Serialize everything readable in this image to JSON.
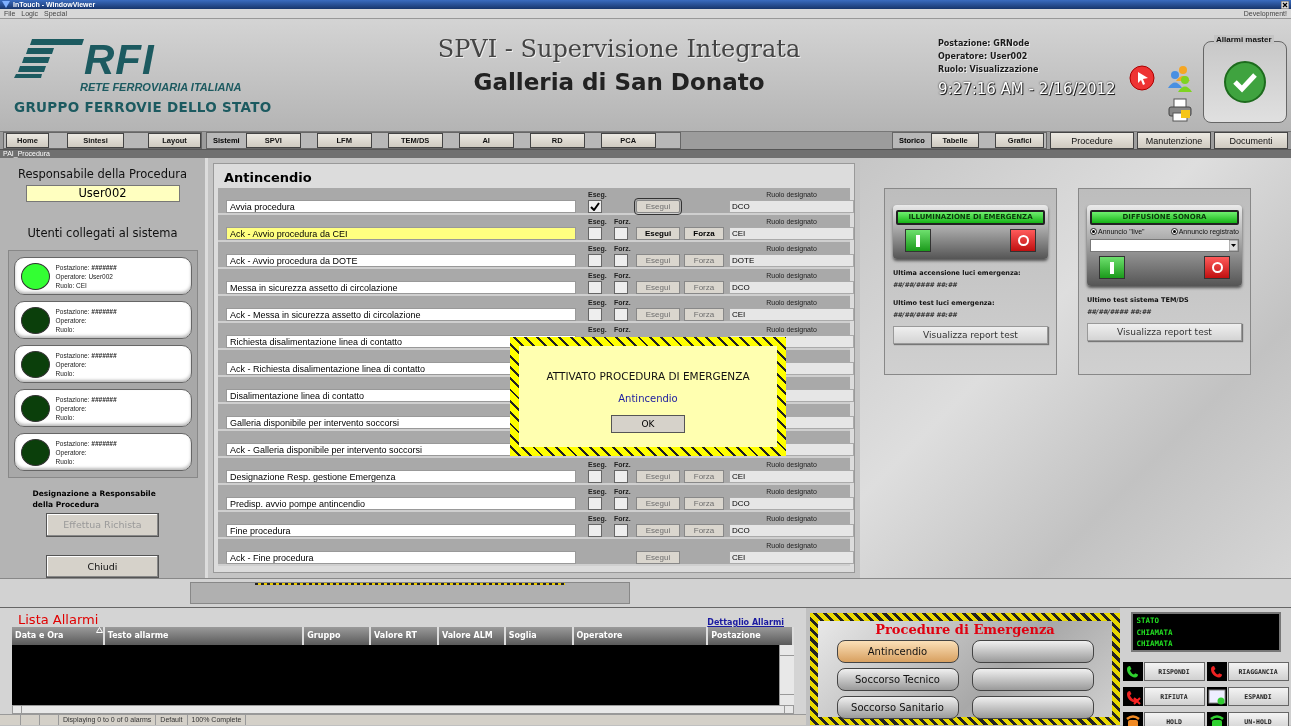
{
  "window": {
    "title": "InTouch - WindowViewer"
  },
  "menu": {
    "items": [
      "File",
      "Logic",
      "Special"
    ],
    "right": "Development!"
  },
  "header": {
    "logo_text": "RFI",
    "logo_subtitle": "RETE FERROVIARIA ITALIANA",
    "logo_group": "GRUPPO FERROVIE DELLO STATO",
    "title": "SPVI - Supervisione Integrata",
    "subtitle": "Galleria di San Donato",
    "postazione": "Postazione: GRNode",
    "operatore": "Operatore: User002",
    "ruolo": "Ruolo: Visualizzazione",
    "datetime": "9:27:16 AM - 2/16/2012",
    "alarm_master": "Allarmi master"
  },
  "nav": {
    "left": [
      "Home",
      "Sintesi",
      "Layout"
    ],
    "systems_label": "Sistemi",
    "systems": [
      "SPVI",
      "LFM",
      "TEM/DS",
      "AI",
      "RD",
      "PCA"
    ],
    "storico_label": "Storico",
    "storico": [
      "Tabelle",
      "Grafici"
    ],
    "right": [
      "Procedure",
      "Manutenzione",
      "Documenti"
    ]
  },
  "page_tab": "PAI_Procedura",
  "left": {
    "responsabile_label": "Responsabile della Procedura",
    "responsabile": "User002",
    "users_label": "Utenti collegati al sistema",
    "users": [
      {
        "postazione": "Postazione:",
        "postazione_value": "#######",
        "operatore": "Operatore: User002",
        "ruolo": "Ruolo: CEI",
        "online": true
      },
      {
        "postazione": "Postazione:",
        "postazione_value": "#######",
        "operatore": "Operatore:",
        "ruolo": "Ruolo:",
        "online": false
      },
      {
        "postazione": "Postazione:",
        "postazione_value": "#######",
        "operatore": "Operatore:",
        "ruolo": "Ruolo:",
        "online": false
      },
      {
        "postazione": "Postazione:",
        "postazione_value": "#######",
        "operatore": "Operatore:",
        "ruolo": "Ruolo:",
        "online": false
      },
      {
        "postazione": "Postazione:",
        "postazione_value": "#######",
        "operatore": "Operatore:",
        "ruolo": "Ruolo:",
        "online": false
      }
    ],
    "designazione": "Designazione a Responsabile della Procedura",
    "request_button": "Effettua Richista",
    "request_disabled": true,
    "close_button": "Chiudi"
  },
  "procedure": {
    "title": "Antincendio",
    "rows": [
      {
        "kind": "start",
        "label": "Avvia procedura",
        "highlight": false,
        "eseg_label": "Eseg.",
        "eseg_checked": true,
        "esegui": "Esegui",
        "enabled": false,
        "focused": true,
        "role_label": "Ruolo designato",
        "role": "DCO"
      },
      {
        "kind": "normal",
        "label": "Ack - Avvio procedura da CEI",
        "highlight": true,
        "eseg_label": "Eseg.",
        "forz_label": "Forz.",
        "eseg_checked": false,
        "forz_checked": false,
        "esegui": "Esegui",
        "forza": "Forza",
        "enabled": true,
        "focused": false,
        "role_label": "Ruolo designato",
        "role": "CEI"
      },
      {
        "kind": "normal",
        "label": "Ack - Avvio procedura da DOTE",
        "highlight": false,
        "eseg_label": "Eseg.",
        "forz_label": "Forz.",
        "eseg_checked": false,
        "forz_checked": false,
        "esegui": "Esegui",
        "forza": "Forza",
        "enabled": false,
        "focused": false,
        "role_label": "Ruolo designato",
        "role": "DOTE"
      },
      {
        "kind": "normal",
        "label": "Messa in sicurezza assetto di circolazione",
        "highlight": false,
        "eseg_label": "Eseg.",
        "forz_label": "Forz.",
        "eseg_checked": false,
        "forz_checked": false,
        "esegui": "Esegui",
        "forza": "Forza",
        "enabled": false,
        "focused": false,
        "role_label": "Ruolo designato",
        "role": "DCO"
      },
      {
        "kind": "normal",
        "label": "Ack - Messa in sicurezza assetto di circolazione",
        "highlight": false,
        "eseg_label": "Eseg.",
        "forz_label": "Forz.",
        "eseg_checked": false,
        "forz_checked": false,
        "esegui": "Esegui",
        "forza": "Forza",
        "enabled": false,
        "focused": false,
        "role_label": "Ruolo designato",
        "role": "CEI"
      },
      {
        "kind": "covered",
        "label": "Richiesta disalimentazione linea di contatto",
        "eseg_label": "Eseg.",
        "forz_label": "Forz.",
        "role_label": "Ruolo designato"
      },
      {
        "kind": "covered",
        "label": "Ack - Richiesta disalimentazione linea di contatto"
      },
      {
        "kind": "covered",
        "label": "Disalimentazione linea di contatto"
      },
      {
        "kind": "covered",
        "label": "Galleria disponibile per intervento soccorsi"
      },
      {
        "kind": "covered",
        "label": "Ack - Galleria disponibile per intervento soccorsi"
      },
      {
        "kind": "normal",
        "label": "Designazione Resp. gestione Emergenza",
        "highlight": false,
        "eseg_label": "Eseg.",
        "forz_label": "Forz.",
        "eseg_checked": false,
        "forz_checked": false,
        "esegui": "Esegui",
        "forza": "Forza",
        "enabled": false,
        "focused": false,
        "role_label": "Ruolo designato",
        "role": "CEI"
      },
      {
        "kind": "normal",
        "label": "Predisp. avvio pompe antincendio",
        "highlight": false,
        "eseg_label": "Eseg.",
        "forz_label": "Forz.",
        "eseg_checked": false,
        "forz_checked": false,
        "esegui": "Esegui",
        "forza": "Forza",
        "enabled": false,
        "focused": false,
        "role_label": "Ruolo designato",
        "role": "DCO"
      },
      {
        "kind": "normal",
        "label": "Fine procedura",
        "highlight": false,
        "eseg_label": "Eseg.",
        "forz_label": "Forz.",
        "eseg_checked": false,
        "forz_checked": false,
        "esegui": "Esegui",
        "forza": "Forza",
        "enabled": false,
        "focused": false,
        "role_label": "Ruolo designato",
        "role": "DCO"
      },
      {
        "kind": "final",
        "label": "Ack - Fine procedura",
        "highlight": false,
        "esegui": "Esegui",
        "enabled": false,
        "focused": false,
        "role_label": "Ruolo designato",
        "role": "CEI"
      }
    ]
  },
  "dialog": {
    "message": "ATTIVATO PROCEDURA DI EMERGENZA",
    "procedure": "Antincendio",
    "ok": "OK"
  },
  "right": {
    "lights": {
      "title": "ILLUMINAZIONE DI EMERGENZA",
      "last_on_label": "Ultima accensione luci emergenza:",
      "last_on": "##/##/#### ##:##",
      "last_test_label": "Ultimo test luci emergenza:",
      "last_test": "##/##/#### ##:##",
      "report_button": "Visualizza report test"
    },
    "sound": {
      "title": "DIFFUSIONE SONORA",
      "radios": [
        {
          "label": "Annuncio \"live\"",
          "selected": true
        },
        {
          "label": "Annuncio registrato",
          "selected": true
        }
      ],
      "last_test_label": "Ultimo test sistema TEM/DS",
      "last_test": "##/##/#### ##:##",
      "report_button": "Visualizza report test"
    }
  },
  "alarms": {
    "title": "Lista Allarmi",
    "detail_link": "Dettaglio Allarmi",
    "columns": [
      "Data e Ora",
      "Testo allarme",
      "Gruppo",
      "Valore RT",
      "Valore ALM",
      "Soglia",
      "Operatore",
      "Postazione"
    ],
    "status": [
      "Displaying 0 to 0 of 0 alarms",
      "Default",
      "100% Complete"
    ]
  },
  "emergency": {
    "title": "Procedure di Emergenza",
    "procedures": [
      {
        "label": "Antincendio",
        "selected": true
      },
      {
        "label": "Soccorso Tecnico",
        "selected": false
      },
      {
        "label": "Soccorso Sanitario",
        "selected": false
      }
    ]
  },
  "phone": {
    "display": [
      "STATO",
      "CHIAMATA",
      "CHIAMATA"
    ],
    "buttons": [
      {
        "kind": "answer",
        "label": "RISPONDI"
      },
      {
        "kind": "hangup",
        "label": "RIAGGANCIA"
      },
      {
        "kind": "reject",
        "label": "RIFIUTA"
      },
      {
        "kind": "expand",
        "label": "ESPANDI"
      },
      {
        "kind": "hold",
        "label": "HOLD"
      },
      {
        "kind": "unhold",
        "label": "UN-HOLD"
      }
    ]
  }
}
